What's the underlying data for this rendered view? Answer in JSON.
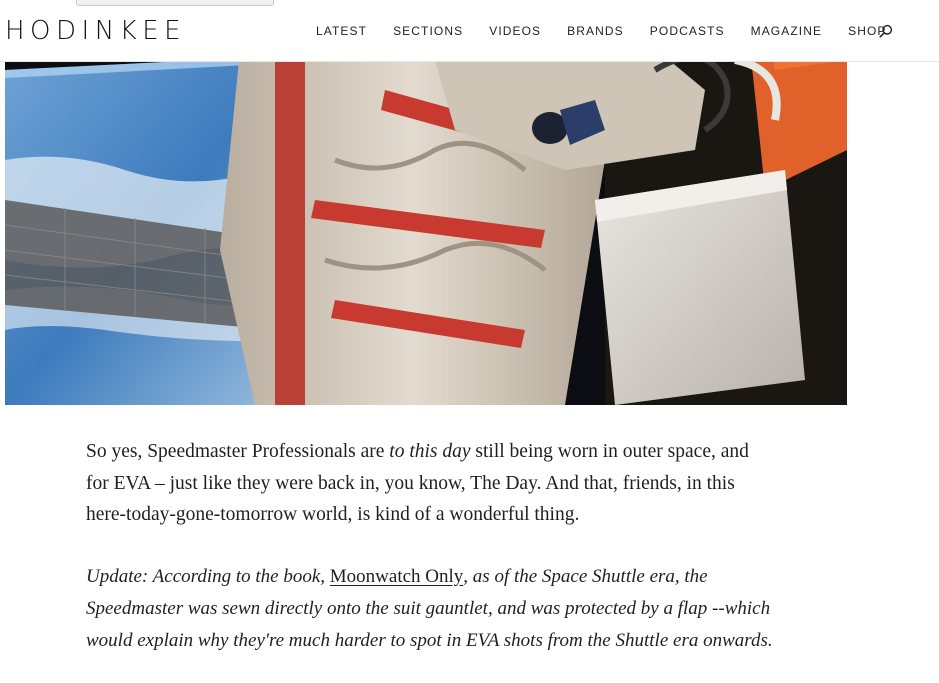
{
  "header": {
    "logo": "HODINKEE",
    "nav": [
      "LATEST",
      "SECTIONS",
      "VIDEOS",
      "BRANDS",
      "PODCASTS",
      "MAGAZINE",
      "SHOP"
    ]
  },
  "article": {
    "para1": {
      "before": "So yes, Speedmaster Professionals are ",
      "emphasis": "to this day",
      "after": " still being worn in outer space, and for EVA – just like they were back in, you know, The Day. And that, friends, in this here-today-gone-tomorrow world, is kind of a wonderful thing."
    },
    "update": {
      "before": "Update: According to the book, ",
      "link": "Moonwatch Only",
      "after": ", as of the Space Shuttle era, the Speedmaster was sewn directly onto the suit gauntlet, and was protected by a flap --which would explain why they're much harder to spot in EVA shots from the Shuttle era onwards."
    }
  },
  "colors": {
    "text": "#1f1f1f",
    "header_bg": "#ffffff",
    "suit": "#d8cfc2",
    "suit_stripe": "#c8392f",
    "earth_ocean": "#2f6fb0"
  }
}
